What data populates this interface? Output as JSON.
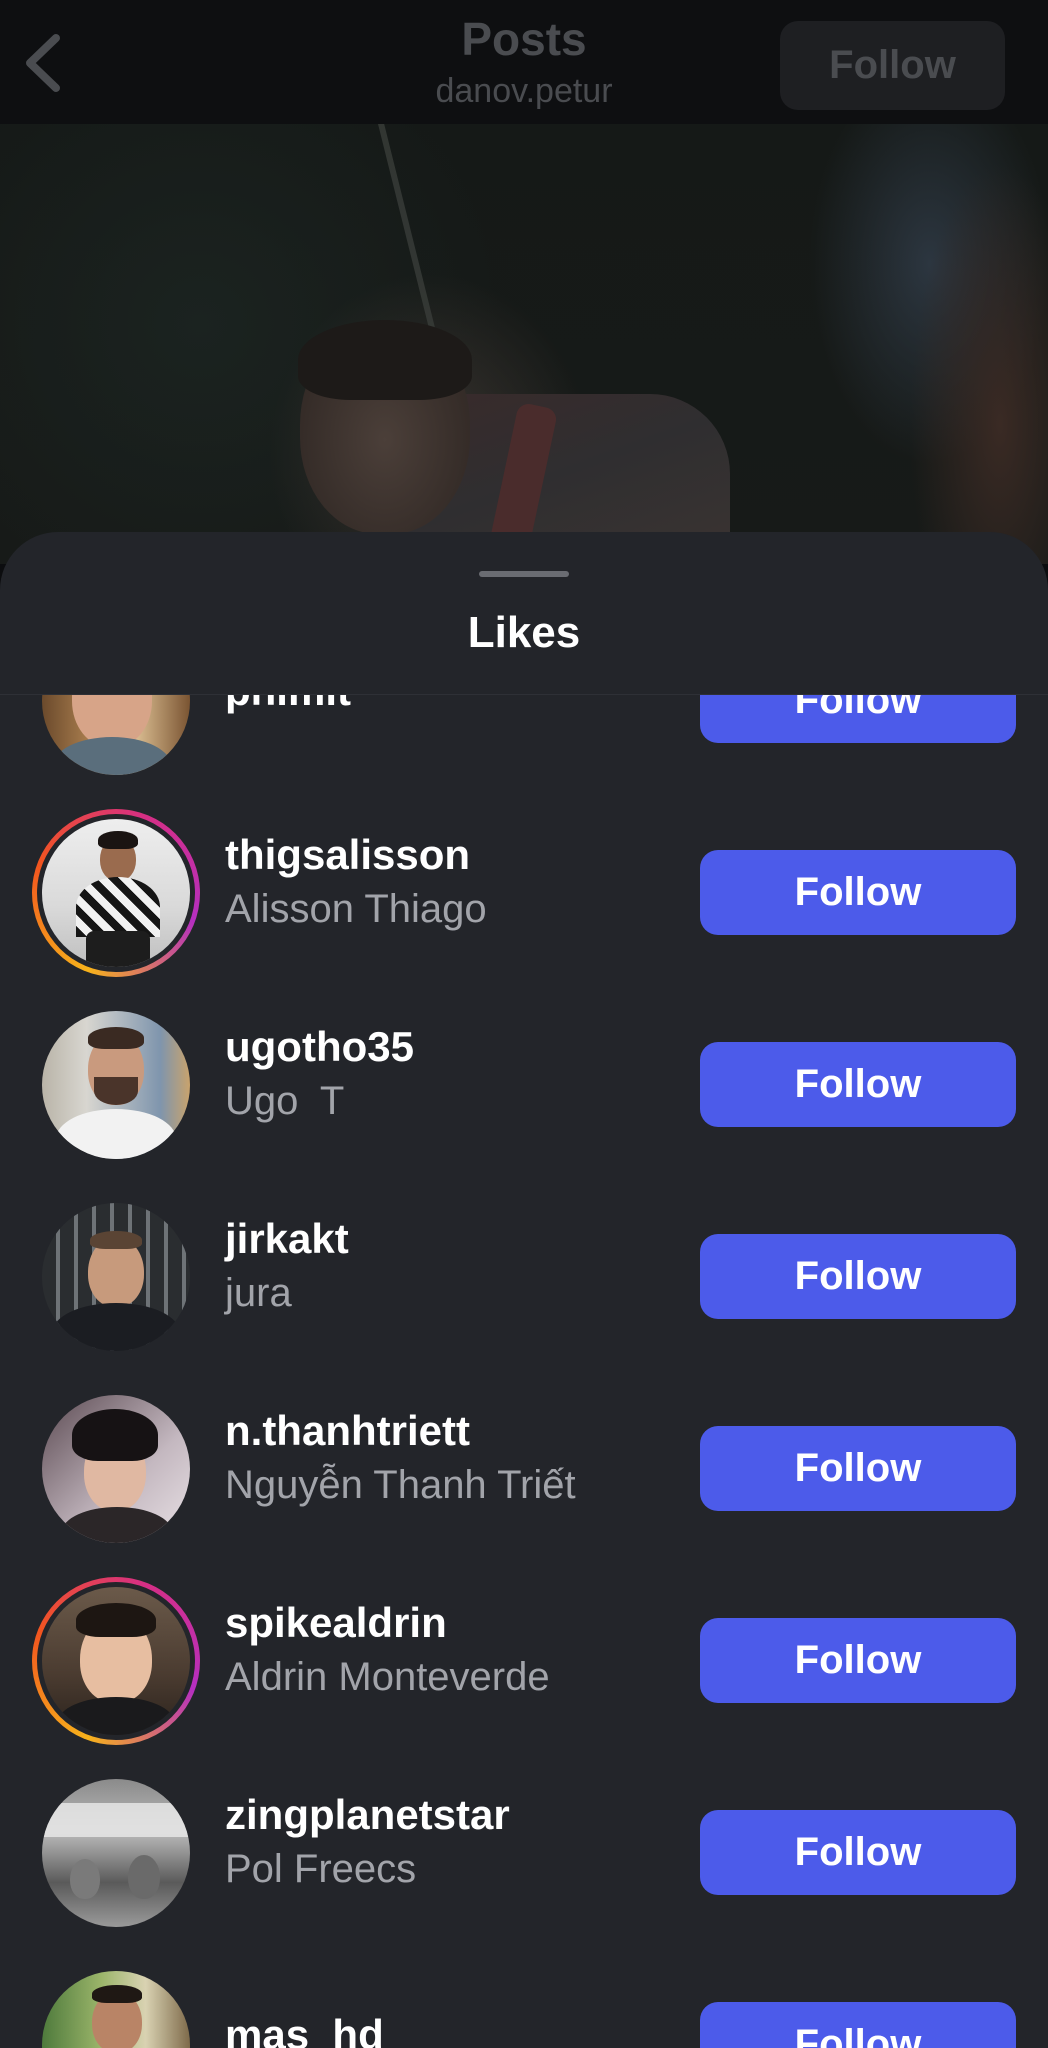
{
  "header": {
    "title": "Posts",
    "subtitle": "danov.petur",
    "follow_label": "Follow"
  },
  "sheet": {
    "title": "Likes"
  },
  "likes": [
    {
      "username": "phimit",
      "fullname": "",
      "button": "Follow",
      "story_ring": false
    },
    {
      "username": "thigsalisson",
      "fullname": "Alisson Thiago",
      "button": "Follow",
      "story_ring": true
    },
    {
      "username": "ugotho35",
      "fullname": "Ugo  T",
      "button": "Follow",
      "story_ring": false
    },
    {
      "username": "jirkakt",
      "fullname": "jura",
      "button": "Follow",
      "story_ring": false
    },
    {
      "username": "n.thanhtriett",
      "fullname": "Nguyễn Thanh Triết",
      "button": "Follow",
      "story_ring": false
    },
    {
      "username": "spikealdrin",
      "fullname": "Aldrin Monteverde",
      "button": "Follow",
      "story_ring": true
    },
    {
      "username": "zingplanetstar",
      "fullname": "Pol Freecs",
      "button": "Follow",
      "story_ring": false
    },
    {
      "username": "mas_hd",
      "fullname": "",
      "button": "Follow",
      "story_ring": false
    }
  ],
  "colors": {
    "follow_button": "#4c5bea",
    "sheet_background": "#23252a",
    "story_ring": [
      "#f7b21b",
      "#d62f84",
      "#b52fc0"
    ]
  }
}
